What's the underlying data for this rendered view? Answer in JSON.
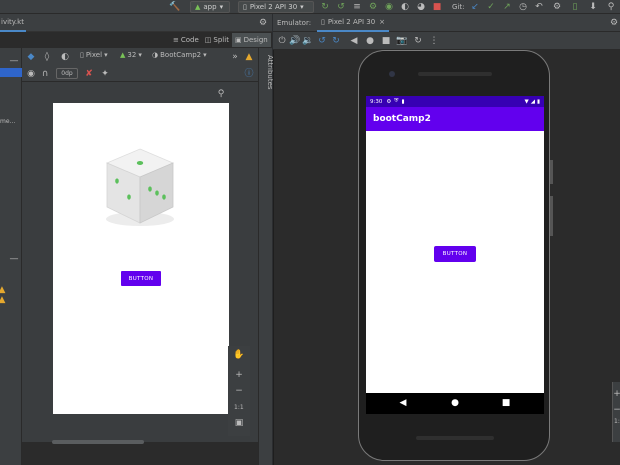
{
  "toolbar": {
    "run_config": "app",
    "device": "Pixel 2 API 30",
    "git_label": "Git:"
  },
  "editor": {
    "file_tab": "ivity.kt",
    "modes": [
      "Code",
      "Split",
      "Design"
    ],
    "active_mode": "Design",
    "device_select": "Pixel",
    "api_select": "32",
    "theme_select": "BootCamp2",
    "margin_value": "0dp",
    "attributes_label": "Attributes",
    "zoom_ratio": "1:1",
    "left_fragment": "me...",
    "button_label": "BUTTON"
  },
  "emulator": {
    "panel_label": "Emulator:",
    "device_tab": "Pixel 2 API 30",
    "status_time": "9:30",
    "app_title": "bootCamp2",
    "button_label": "BUTTON"
  },
  "right_edge": {
    "zoom_label": "1:"
  },
  "colors": {
    "accent": "#6200ee",
    "status_bar": "#3700b3",
    "ide_bg": "#2b2b2b",
    "panel_bg": "#3c3f41"
  }
}
